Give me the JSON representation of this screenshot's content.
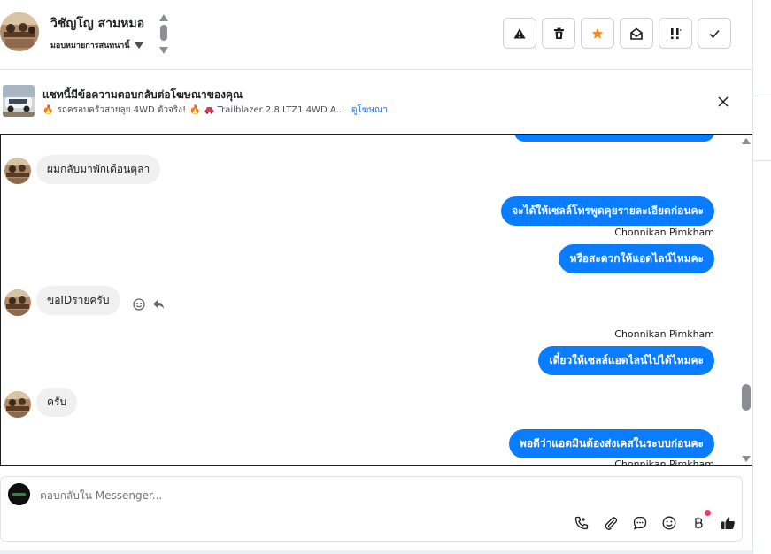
{
  "header": {
    "contact_name": "วิชัญโญ สามหมอ",
    "assign_label": "มอบหมายการสนทนานี้",
    "actions": [
      "warning-icon",
      "trash-icon",
      "star-icon",
      "mark-unread-icon",
      "follow-up-icon",
      "done-icon"
    ],
    "star_color": "#f28c28"
  },
  "ad_banner": {
    "title": "แชทนี้มีข้อความตอบกลับต่อโฆษณาของคุณ",
    "subtitle": "รถครอบครัวสายลุย 4WD ตัวจริง!",
    "subtitle_tail": "Trailblazer 2.8 LTZ1 4WD A...",
    "link": "ดูโฆษณา"
  },
  "messages": [
    {
      "direction": "in",
      "text": "ผมกลับมาพักเดือนตุลา"
    },
    {
      "direction": "out",
      "text": "จะได้ให้เซลล์โทรพูดคุยรายละเอียดก่อนคะ"
    },
    {
      "direction": "out",
      "sender": "Chonnikan Pimkham",
      "text": "หรือสะดวกให้แอดไลน์ไหมคะ"
    },
    {
      "direction": "in",
      "text": "ขอIDรายครับ"
    },
    {
      "direction": "out",
      "sender": "Chonnikan Pimkham",
      "text": "เดี๋ยวให้เซลล์แอดไลน์ไปได้ไหมคะ"
    },
    {
      "direction": "in",
      "text": "ครับ"
    },
    {
      "direction": "out",
      "text": "พอดีว่าแอดมินต้องส่งเคสในระบบก่อนคะ"
    },
    {
      "direction": "out",
      "sender": "Chonnikan Pimkham"
    }
  ],
  "composer": {
    "placeholder": "ตอบกลับใน Messenger...",
    "tools": [
      "call-icon",
      "attachment-icon",
      "saved-reply-icon",
      "emoji-icon",
      "baht-icon",
      "thumbs-up-icon"
    ]
  },
  "colors": {
    "outgoing_bubble": "#0a7cff",
    "incoming_bubble": "#f0f0f0",
    "link": "#216fdb"
  }
}
